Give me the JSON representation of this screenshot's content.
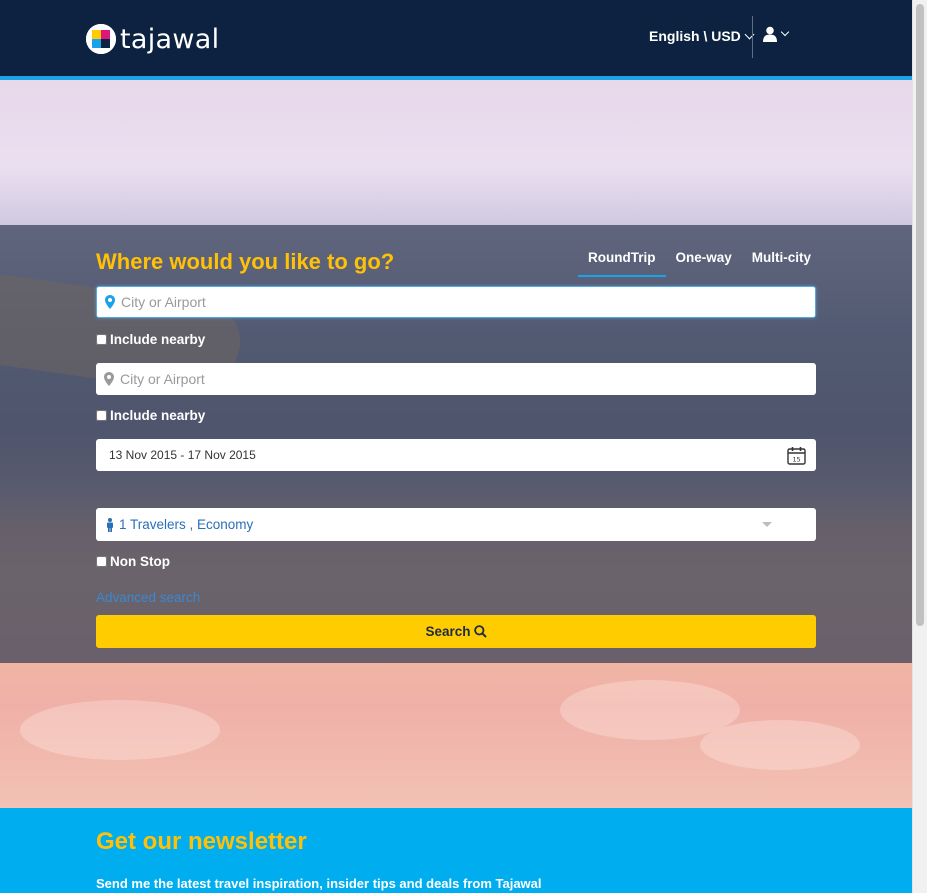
{
  "header": {
    "logo_text": "tajawal",
    "language_currency": "English \\ USD",
    "user_icon": "user-icon"
  },
  "search": {
    "title": "Where would you like to go?",
    "tabs": [
      {
        "label": "RoundTrip",
        "active": true
      },
      {
        "label": "One-way",
        "active": false
      },
      {
        "label": "Multi-city",
        "active": false
      }
    ],
    "origin": {
      "placeholder": "City or Airport",
      "value": "",
      "icon": "map-pin-icon"
    },
    "origin_nearby_label": "Include nearby",
    "destination": {
      "placeholder": "City or Airport",
      "value": "",
      "icon": "map-pin-icon"
    },
    "destination_nearby_label": "Include nearby",
    "dates": "13 Nov 2015 - 17 Nov 2015",
    "travelers": "1 Travelers , Economy",
    "non_stop_label": "Non Stop",
    "advanced_search_label": "Advanced search",
    "search_button_label": "Search"
  },
  "newsletter": {
    "title": "Get our newsletter",
    "text": "Send me the latest travel inspiration, insider tips and deals from ",
    "brand": "Tajawal"
  },
  "colors": {
    "header_bg": "#0d2240",
    "accent_blue": "#1aa3e8",
    "title_yellow": "#ffc107",
    "search_button": "#ffcc00",
    "newsletter_bg": "#00aeef"
  }
}
